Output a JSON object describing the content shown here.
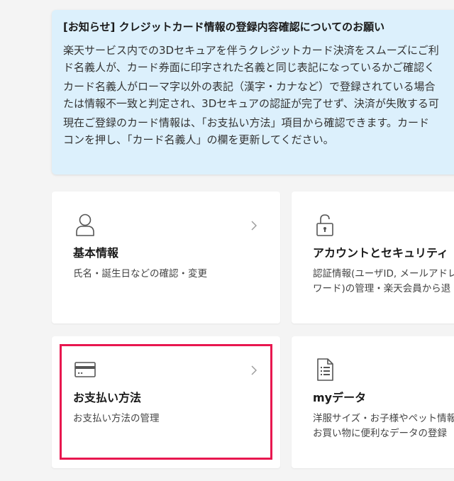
{
  "notice": {
    "title": "[お知らせ] クレジットカード情報の登録内容確認についてのお願い",
    "paragraphs": [
      [
        "楽天サービス内での3Dセキュアを伴うクレジットカード決済をスムーズにご利",
        "ド名義人が、カード券面に印字された名義と同じ表記になっているかご確認く"
      ],
      [
        "カード名義人がローマ字以外の表記（漢字・カナなど）で登録されている場合",
        "たは情報不一致と判定され、3Dセキュアの認証が完了せず、決済が失敗する可"
      ],
      [
        "現在ご登録のカード情報は、「お支払い方法」項目から確認できます。カード",
        "コンを押し、「カード名義人」の欄を更新してください。"
      ]
    ]
  },
  "cards": {
    "basic_info": {
      "icon": "person-icon",
      "title": "基本情報",
      "desc": [
        "氏名・誕生日などの確認・変更"
      ]
    },
    "account_security": {
      "icon": "lock-icon",
      "title": "アカウントとセキュリティ",
      "desc": [
        "認証情報(ユーザID, メールアドレ",
        "ワード)の管理・楽天会員から退"
      ]
    },
    "payment": {
      "icon": "credit-card-icon",
      "title": "お支払い方法",
      "desc": [
        "お支払い方法の管理"
      ]
    },
    "my_data": {
      "icon": "document-list-icon",
      "title": "myデータ",
      "desc": [
        "洋服サイズ・お子様やペット情報",
        "お買い物に便利なデータの登録"
      ]
    }
  },
  "colors": {
    "notice_bg": "#dcf0fc",
    "highlight": "#e8174f",
    "page_bg": "#f4f4f4"
  }
}
